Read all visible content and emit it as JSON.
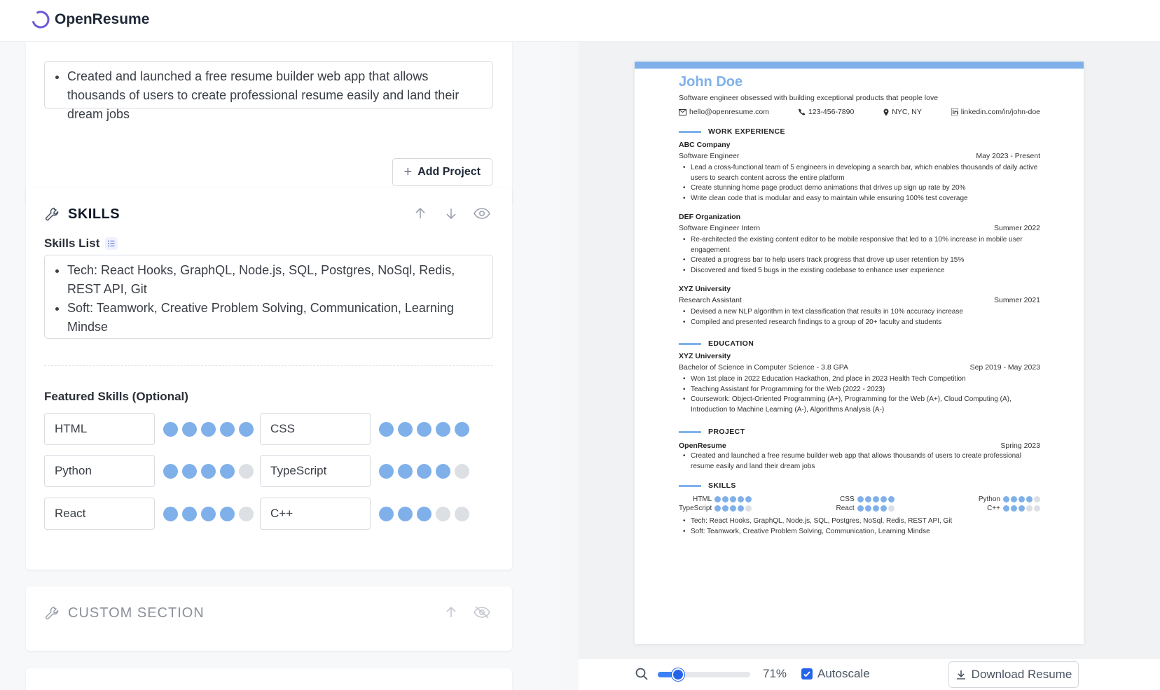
{
  "app": {
    "name": "OpenResume"
  },
  "projects": {
    "description_bullets": [
      "Created and launched a free resume builder web app that allows thousands of users to create professional resume easily and land their dream jobs"
    ],
    "add_button": "Add Project"
  },
  "skills": {
    "title": "SKILLS",
    "list_label": "Skills List",
    "list_bullets": [
      "Tech: React Hooks, GraphQL, Node.js, SQL, Postgres, NoSql, Redis, REST API, Git",
      "Soft: Teamwork, Creative Problem Solving, Communication, Learning Mindse"
    ],
    "featured_label": "Featured Skills (Optional)",
    "featured": [
      {
        "name": "HTML",
        "rating": 5
      },
      {
        "name": "CSS",
        "rating": 5
      },
      {
        "name": "Python",
        "rating": 4
      },
      {
        "name": "TypeScript",
        "rating": 4
      },
      {
        "name": "React",
        "rating": 4
      },
      {
        "name": "C++",
        "rating": 3
      }
    ]
  },
  "custom_section": {
    "title": "CUSTOM SECTION"
  },
  "resume": {
    "name": "John Doe",
    "summary": "Software engineer obsessed with building exceptional products that people love",
    "email": "hello@openresume.com",
    "phone": "123-456-7890",
    "location": "NYC, NY",
    "url": "linkedin.com/in/john-doe",
    "work_heading": "WORK EXPERIENCE",
    "work": [
      {
        "company": "ABC Company",
        "title": "Software Engineer",
        "date": "May 2023 - Present",
        "bullets": [
          "Lead a cross-functional team of 5 engineers in developing a search bar, which enables thousands of daily active users to search content across the entire platform",
          "Create stunning home page product demo animations that drives up sign up rate by 20%",
          "Write clean code that is modular and easy to maintain while ensuring 100% test coverage"
        ]
      },
      {
        "company": "DEF Organization",
        "title": "Software Engineer Intern",
        "date": "Summer 2022",
        "bullets": [
          "Re-architected the existing content editor to be mobile responsive that led to a 10% increase in mobile user engagement",
          "Created a progress bar to help users track progress that drove up user retention by 15%",
          "Discovered and fixed 5 bugs in the existing codebase to enhance user experience"
        ]
      },
      {
        "company": "XYZ University",
        "title": "Research Assistant",
        "date": "Summer 2021",
        "bullets": [
          "Devised a new NLP algorithm in text classification that results in 10% accuracy increase",
          "Compiled and presented research findings to a group of 20+ faculty and students"
        ]
      }
    ],
    "education_heading": "EDUCATION",
    "education": {
      "school": "XYZ University",
      "degree": "Bachelor of Science in Computer Science - 3.8 GPA",
      "date": "Sep 2019 - May 2023",
      "bullets": [
        "Won 1st place in 2022 Education Hackathon, 2nd place in 2023 Health Tech Competition",
        "Teaching Assistant for Programming for the Web (2022 - 2023)",
        "Coursework: Object-Oriented Programming (A+), Programming for the Web (A+), Cloud Computing (A), Introduction to Machine Learning (A-), Algorithms Analysis (A-)"
      ]
    },
    "project_heading": "PROJECT",
    "project": {
      "name": "OpenResume",
      "date": "Spring 2023",
      "bullets": [
        "Created and launched a free resume builder web app that allows thousands of users to create professional resume easily and land their dream jobs"
      ]
    },
    "skills_heading": "SKILLS",
    "skills_bullets": [
      "Tech: React Hooks, GraphQL, Node.js, SQL, Postgres, NoSql, Redis, REST API, Git",
      "Soft: Teamwork, Creative Problem Solving, Communication, Learning Mindse"
    ]
  },
  "toolbar": {
    "zoom": "71%",
    "zoom_fraction": 0.22,
    "autoscale_label": "Autoscale",
    "autoscale_checked": true,
    "download_label": "Download Resume"
  },
  "colors": {
    "accent": "#7fb0ea",
    "primary": "#2563eb"
  },
  "icons": [
    "logo-icon",
    "wrench-icon",
    "arrow-up-icon",
    "arrow-down-icon",
    "eye-icon",
    "eye-off-icon",
    "bullet-list-icon",
    "plus-icon",
    "mail-icon",
    "phone-icon",
    "pin-icon",
    "linkedin-icon",
    "search-icon",
    "download-icon",
    "check-icon"
  ]
}
